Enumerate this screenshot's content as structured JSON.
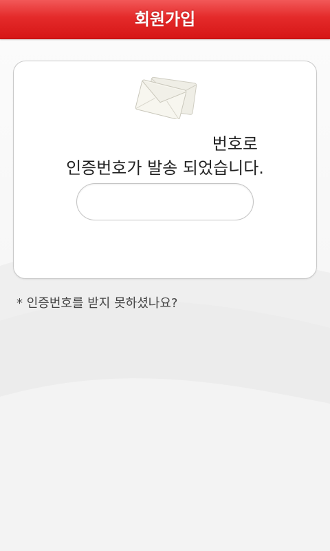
{
  "header": {
    "title": "회원가입"
  },
  "card": {
    "line1": "번호로",
    "line2": "인증번호가 발송 되었습니다.",
    "code_input": {
      "value": "",
      "placeholder": ""
    }
  },
  "links": {
    "resend_label": "* 인증번호를 받지 못하셨나요?"
  },
  "colors": {
    "header_red": "#e42a2a",
    "background": "#f6f6f6"
  },
  "icons": {
    "envelope": "envelope-icon"
  }
}
